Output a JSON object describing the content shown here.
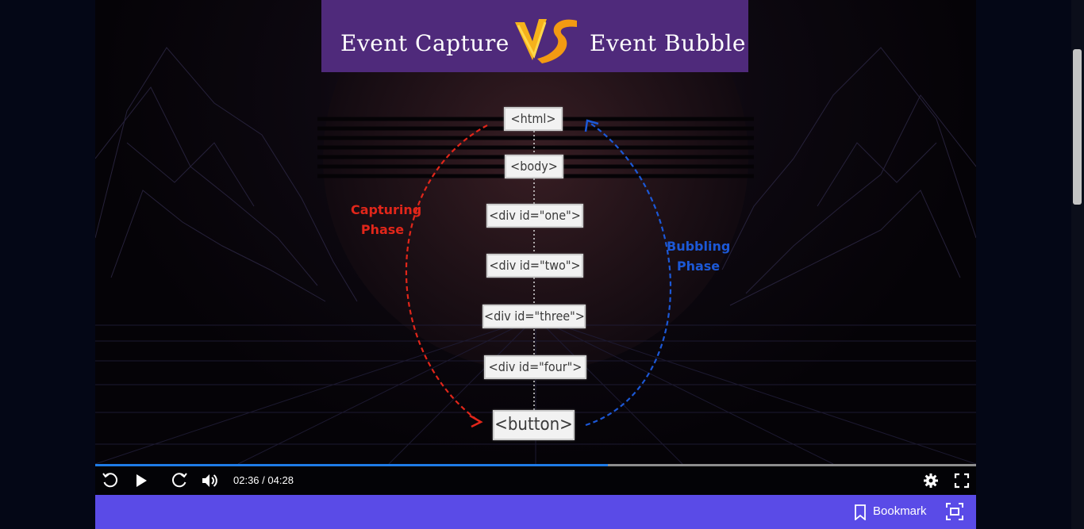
{
  "slide": {
    "title_left": "Event Capture",
    "title_vs": "VS",
    "title_right": "Event Bubble",
    "tags": [
      "<html>",
      "<body>",
      "<div id=\"one\">",
      "<div id=\"two\">",
      "<div id=\"three\">",
      "<div id=\"four\">",
      "<button>"
    ],
    "capture_label_line1": "Capturing",
    "capture_label_line2": "Phase",
    "bubble_label_line1": "Bubbling",
    "bubble_label_line2": "Phase",
    "colors": {
      "capture": "#e1261a",
      "bubble": "#1c58d6",
      "banner": "#4f2a7b"
    }
  },
  "player": {
    "current_time": "02:36",
    "duration": "04:28",
    "time_separator": " / ",
    "progress_fraction": 0.582,
    "icons": [
      "rewind-icon",
      "play-icon",
      "forward-icon",
      "volume-icon",
      "settings-icon",
      "fullscreen-icon"
    ]
  },
  "bottom_bar": {
    "bookmark_label": "Bookmark",
    "accent": "#5a4be7"
  }
}
